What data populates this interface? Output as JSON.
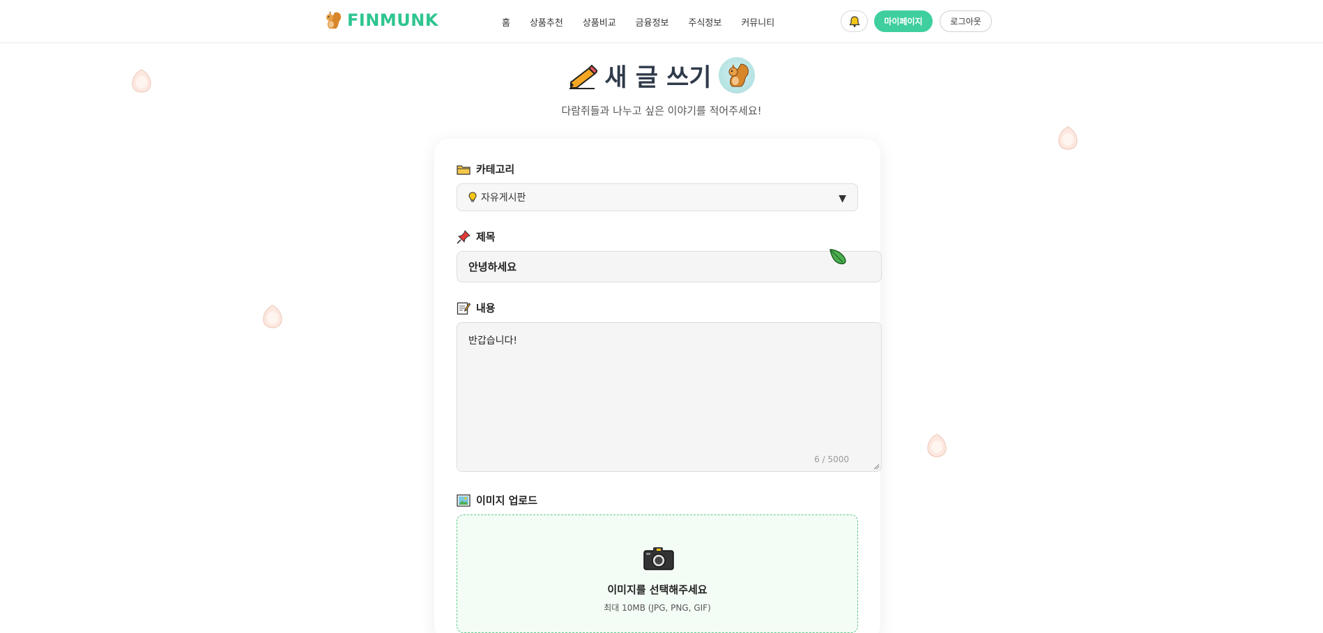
{
  "header": {
    "brand": "FINMUNK",
    "nav": [
      "홈",
      "상품추천",
      "상품비교",
      "금융정보",
      "주식정보",
      "커뮤니티"
    ],
    "mypage_label": "마이페이지",
    "logout_label": "로그아웃"
  },
  "page": {
    "title": "새 글 쓰기",
    "subtitle": "다람쥐들과 나누고 싶은 이야기를 적어주세요!"
  },
  "form": {
    "category_label": "카테고리",
    "category_value": "자유게시판",
    "title_label": "제목",
    "title_value": "안녕하세요",
    "content_label": "내용",
    "content_value": "반갑습니다!",
    "char_count": "6 / 5000",
    "image_label": "이미지 업로드",
    "upload_main": "이미지를 선택해주세요",
    "upload_sub": "최대 10MB (JPG, PNG, GIF)"
  },
  "colors": {
    "brand": "#2ec58f",
    "mypage_bg": "#3fcf9f",
    "upload_border": "#5ec98a",
    "title_text": "#2f3a4a"
  },
  "icons": [
    "squirrel-icon",
    "bell-icon",
    "pencil-icon",
    "folder-icon",
    "lightbulb-icon",
    "pushpin-icon",
    "memo-icon",
    "picture-icon",
    "camera-icon",
    "leaf-cursor-icon",
    "acorn-icon"
  ]
}
